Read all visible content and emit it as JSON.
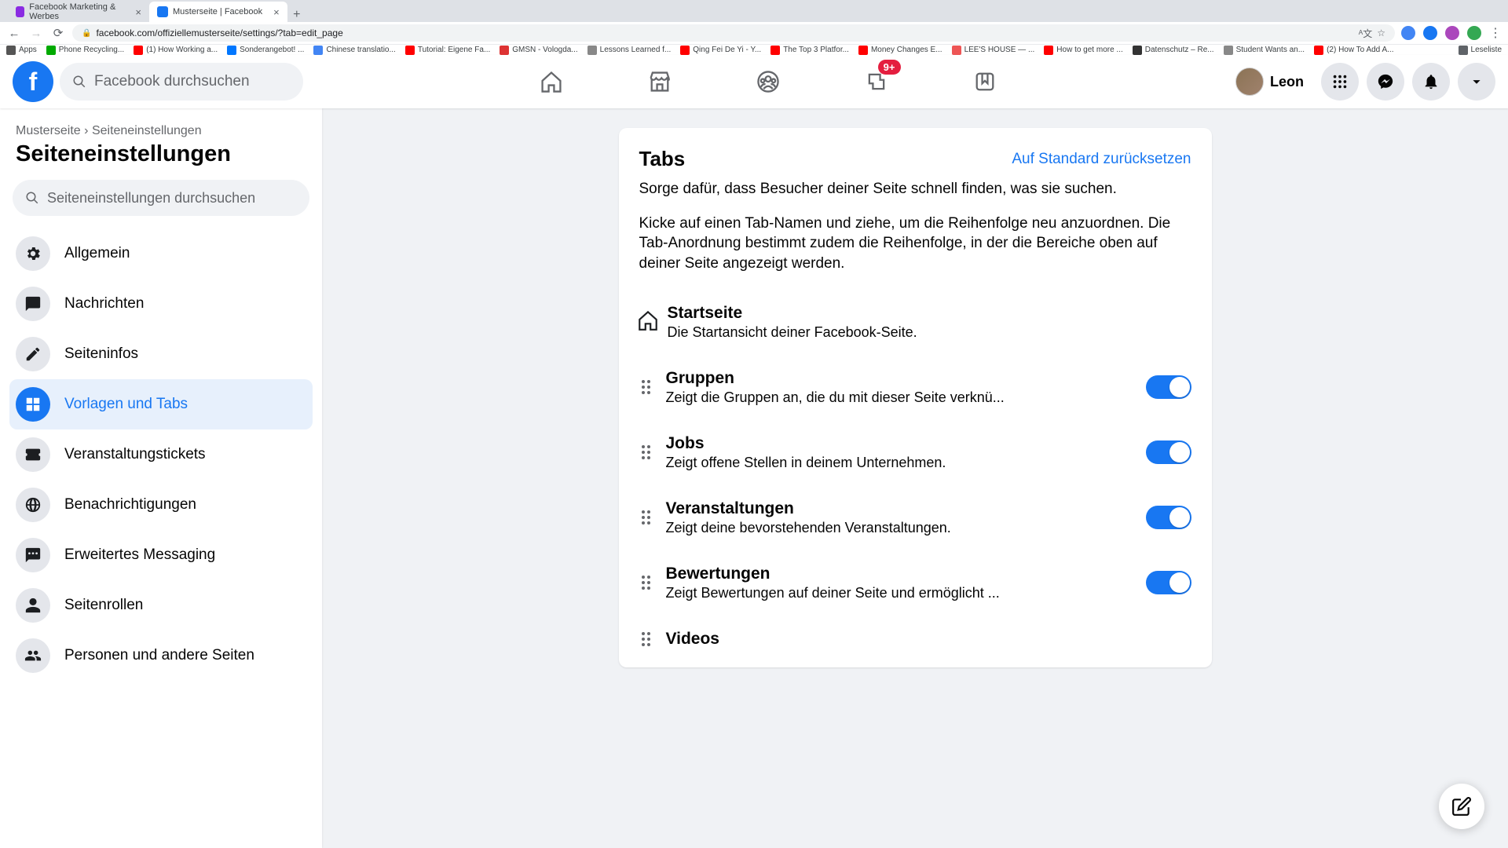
{
  "browser": {
    "tabs": [
      {
        "title": "Facebook Marketing & Werbes",
        "active": false
      },
      {
        "title": "Musterseite | Facebook",
        "active": true
      }
    ],
    "url": "facebook.com/offiziellemusterseite/settings/?tab=edit_page",
    "bookmarks": [
      "Apps",
      "Phone Recycling...",
      "(1) How Working a...",
      "Sonderangebot! ...",
      "Chinese translatio...",
      "Tutorial: Eigene Fa...",
      "GMSN - Vologda...",
      "Lessons Learned f...",
      "Qing Fei De Yi - Y...",
      "The Top 3 Platfor...",
      "Money Changes E...",
      "LEE'S HOUSE — ...",
      "How to get more ...",
      "Datenschutz – Re...",
      "Student Wants an...",
      "(2) How To Add A..."
    ],
    "reading_list": "Leseliste"
  },
  "topnav": {
    "search_placeholder": "Facebook durchsuchen",
    "badge": "9+",
    "username": "Leon"
  },
  "sidebar": {
    "breadcrumb": {
      "root": "Musterseite",
      "current": "Seiteneinstellungen"
    },
    "heading": "Seiteneinstellungen",
    "search_placeholder": "Seiteneinstellungen durchsuchen",
    "items": [
      {
        "label": "Allgemein",
        "icon": "gear"
      },
      {
        "label": "Nachrichten",
        "icon": "chat"
      },
      {
        "label": "Seiteninfos",
        "icon": "pencil"
      },
      {
        "label": "Vorlagen und Tabs",
        "icon": "grid",
        "active": true
      },
      {
        "label": "Veranstaltungstickets",
        "icon": "ticket"
      },
      {
        "label": "Benachrichtigungen",
        "icon": "globe"
      },
      {
        "label": "Erweitertes Messaging",
        "icon": "chat-dots"
      },
      {
        "label": "Seitenrollen",
        "icon": "person"
      },
      {
        "label": "Personen und andere Seiten",
        "icon": "people"
      }
    ]
  },
  "card": {
    "title": "Tabs",
    "reset": "Auf Standard zurücksetzen",
    "desc1": "Sorge dafür, dass Besucher deiner Seite schnell finden, was sie suchen.",
    "desc2": "Kicke auf einen Tab-Namen und ziehe, um die Reihenfolge neu anzuordnen. Die Tab-Anordnung bestimmt zudem die Reihenfolge, in der die Bereiche oben auf deiner Seite angezeigt werden.",
    "tabs": [
      {
        "name": "Startseite",
        "desc": "Die Startansicht deiner Facebook-Seite.",
        "fixed": true
      },
      {
        "name": "Gruppen",
        "desc": "Zeigt die Gruppen an, die du mit dieser Seite verknü...",
        "on": true
      },
      {
        "name": "Jobs",
        "desc": "Zeigt offene Stellen in deinem Unternehmen.",
        "on": true
      },
      {
        "name": "Veranstaltungen",
        "desc": "Zeigt deine bevorstehenden Veranstaltungen.",
        "on": true
      },
      {
        "name": "Bewertungen",
        "desc": "Zeigt Bewertungen auf deiner Seite und ermöglicht ...",
        "on": true
      },
      {
        "name": "Videos",
        "desc": "",
        "on": true
      }
    ]
  }
}
